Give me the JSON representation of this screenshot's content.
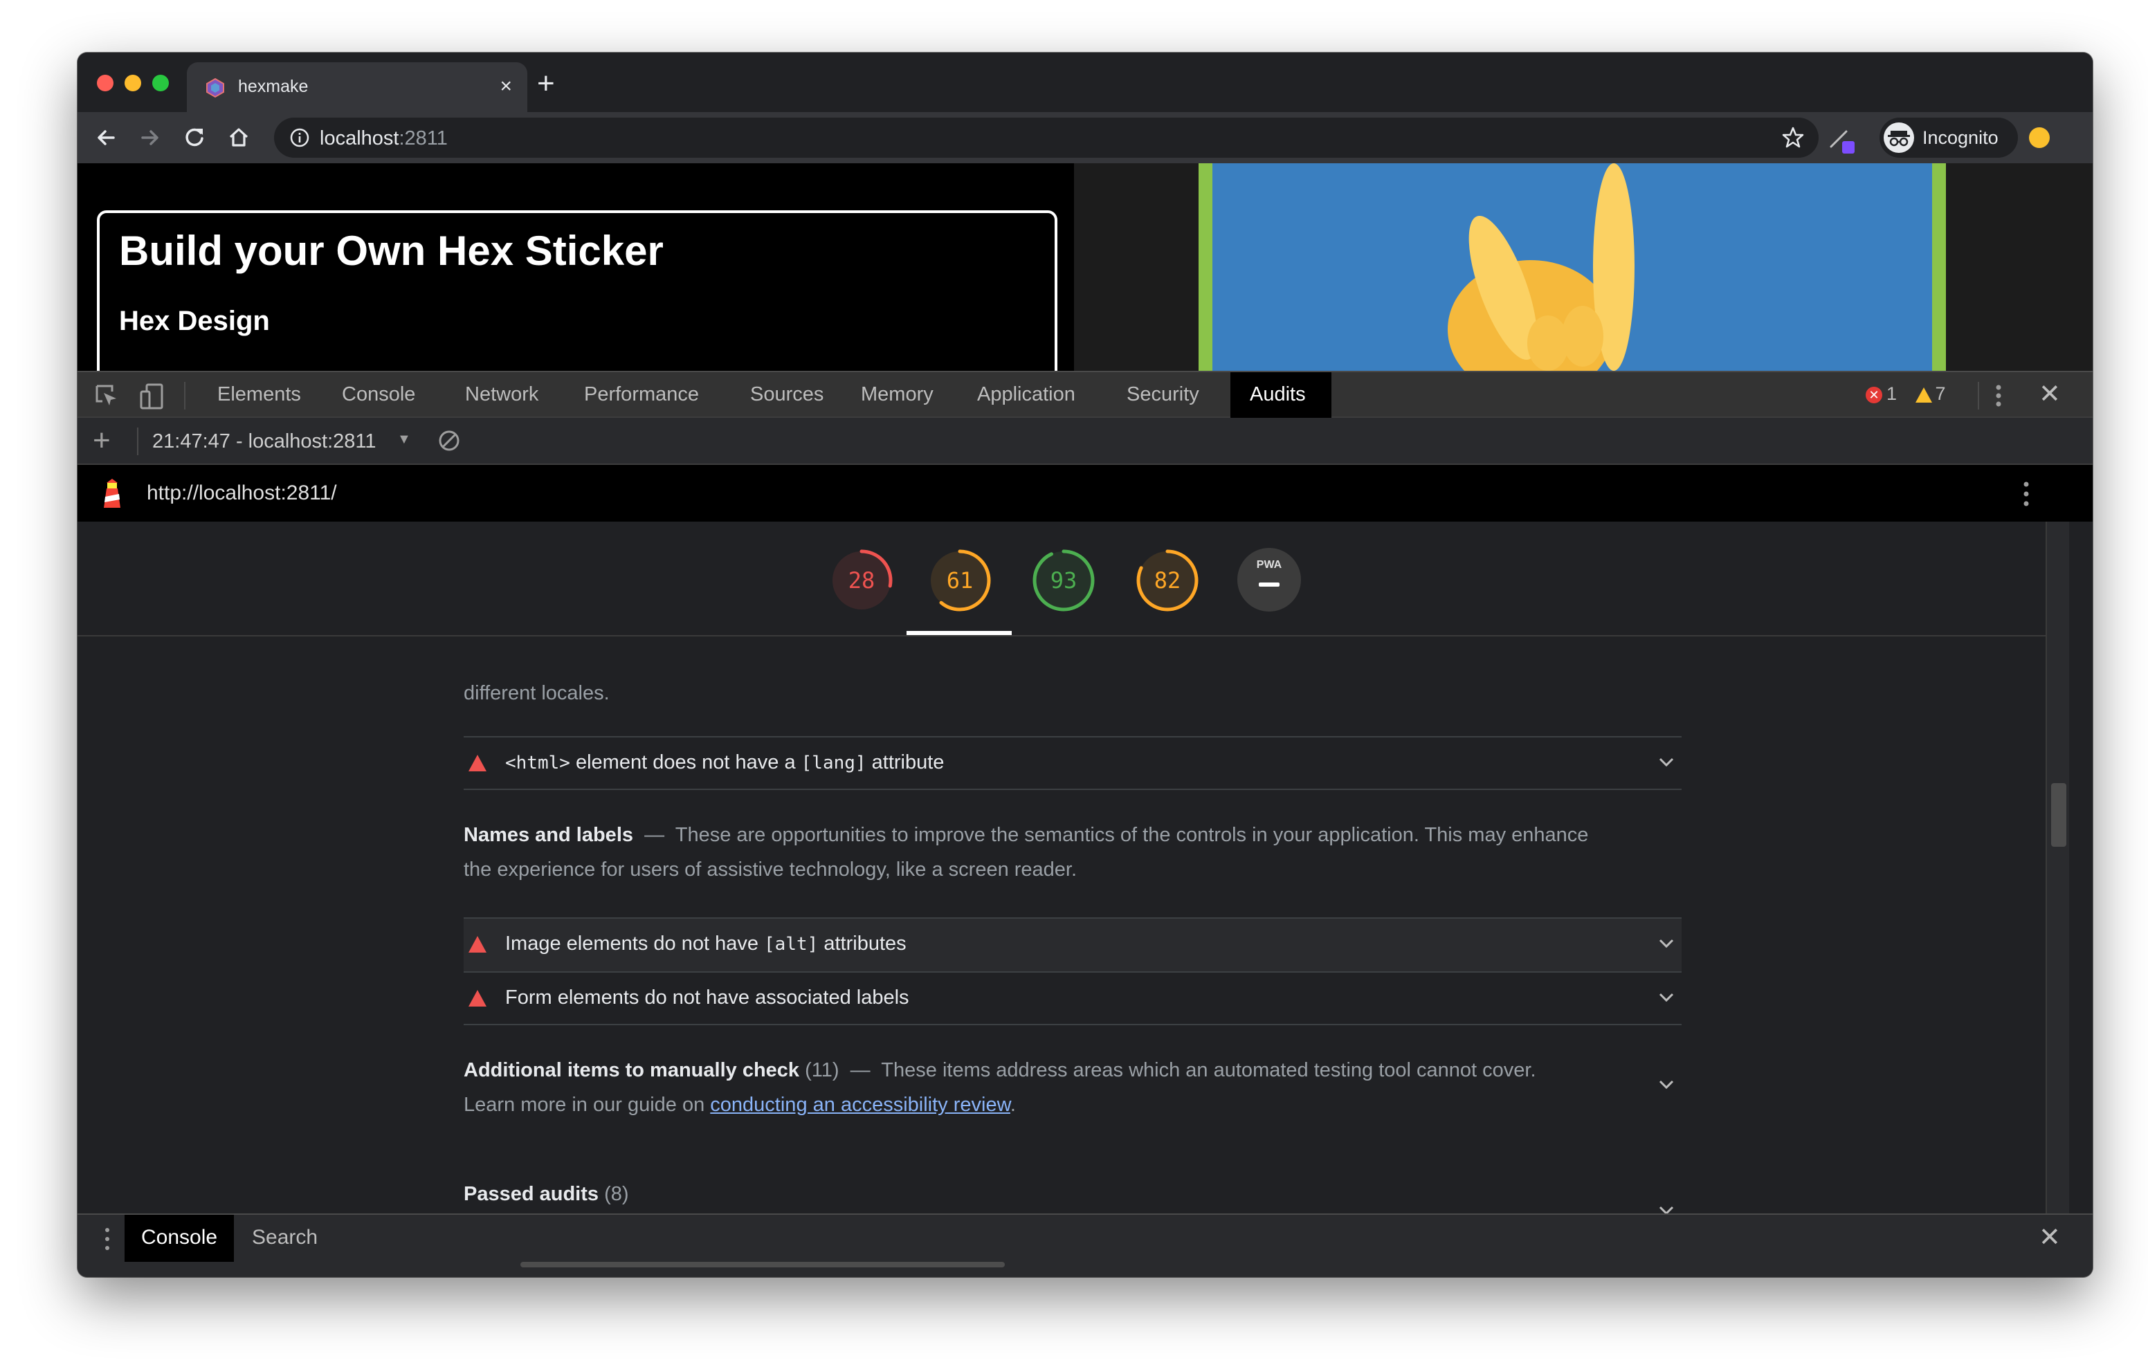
{
  "browser": {
    "tab_title": "hexmake",
    "tab_close": "×",
    "new_tab": "+",
    "url_host": "localhost",
    "url_port": ":2811",
    "profile_label": "Incognito"
  },
  "page": {
    "title": "Build your Own Hex Sticker",
    "subtitle": "Hex Design"
  },
  "devtools": {
    "tabs": [
      {
        "label": "Elements"
      },
      {
        "label": "Console"
      },
      {
        "label": "Network"
      },
      {
        "label": "Performance"
      },
      {
        "label": "Sources"
      },
      {
        "label": "Memory"
      },
      {
        "label": "Application"
      },
      {
        "label": "Security"
      },
      {
        "label": "Audits"
      }
    ],
    "active_tab": "Audits",
    "error_count": "1",
    "warning_count": "7",
    "close": "✕"
  },
  "audits": {
    "new_audit": "+",
    "session": "21:47:47 - localhost:2811",
    "caret": "▼",
    "report_url": "http://localhost:2811/",
    "scores": [
      {
        "value": "28",
        "color": "#ef5350",
        "fraction": 0.28
      },
      {
        "value": "61",
        "color": "#ffa726",
        "fraction": 0.61
      },
      {
        "value": "93",
        "color": "#4caf50",
        "fraction": 0.93
      },
      {
        "value": "82",
        "color": "#ffa726",
        "fraction": 0.82
      }
    ],
    "pwa_label": "PWA",
    "fragment": "different locales.",
    "lang_row": {
      "code": "<html>",
      "text1": " element does not have a ",
      "code2": "[lang]",
      "text2": " attribute"
    },
    "names_group": {
      "title": "Names and labels",
      "dash": "—",
      "description": "These are opportunities to improve the semantics of the controls in your application. This may enhance the experience for users of assistive technology, like a screen reader."
    },
    "alt_row": {
      "text1": "Image elements do not have ",
      "code": "[alt]",
      "text2": " attributes"
    },
    "form_row": {
      "text": "Form elements do not have associated labels"
    },
    "manual_group": {
      "title": "Additional items to manually check",
      "count": "(11)",
      "dash": "—",
      "description": "These items address areas which an automated testing tool cannot cover.",
      "learn_prefix": "Learn more in our guide on ",
      "link_text": "conducting an accessibility review",
      "suffix": "."
    },
    "passed": {
      "title": "Passed audits",
      "count": "(8)"
    }
  },
  "drawer": {
    "tabs": [
      {
        "label": "Console"
      },
      {
        "label": "Search"
      }
    ],
    "close": "✕"
  },
  "colors": {
    "fail": "#ef5350",
    "average": "#ffa726",
    "pass": "#4caf50",
    "link": "#8ab4f8"
  }
}
